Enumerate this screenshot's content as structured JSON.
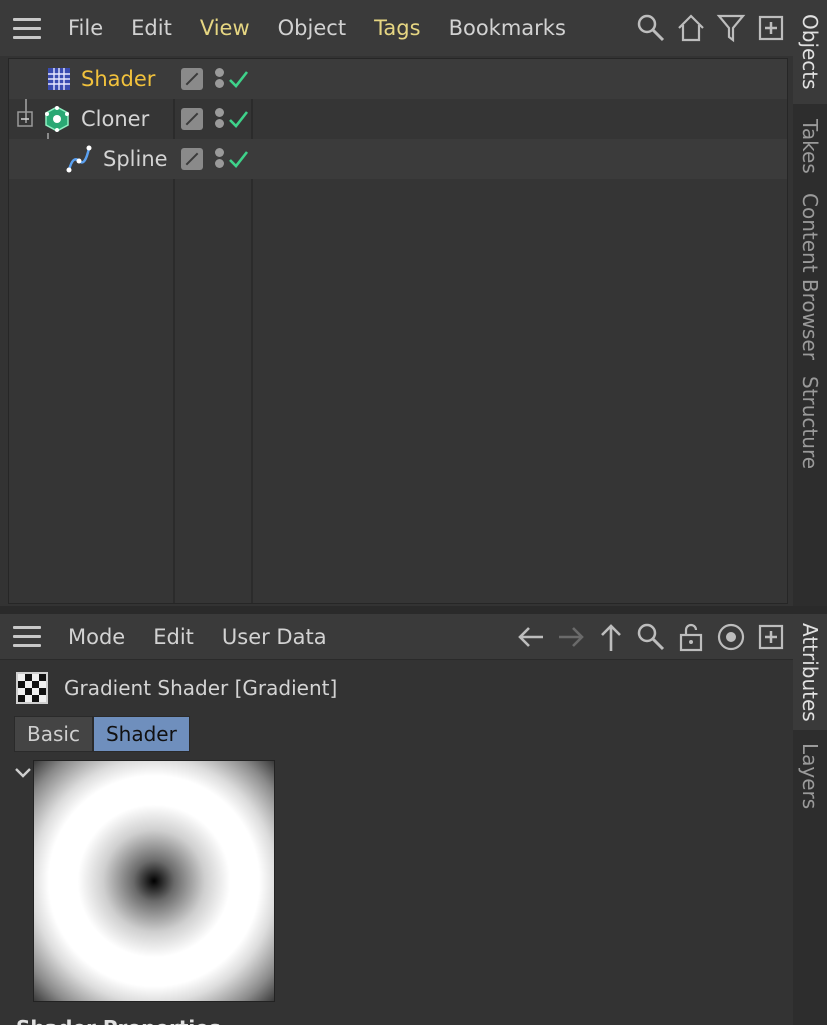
{
  "object_manager": {
    "menu": [
      "File",
      "Edit",
      "View",
      "Object",
      "Tags",
      "Bookmarks"
    ],
    "highlighted_menu": [
      "View",
      "Tags"
    ],
    "toolbar_icons": [
      "search-icon",
      "home-icon",
      "filter-icon",
      "new-window-icon"
    ],
    "objects": [
      {
        "name": "Shader",
        "icon": "shader-grid-icon",
        "selected": true
      },
      {
        "name": "Cloner",
        "icon": "cloner-icon",
        "selected": false
      },
      {
        "name": "Spline",
        "icon": "spline-icon",
        "selected": false
      }
    ]
  },
  "side_tabs_top": [
    "Objects",
    "Takes",
    "Content Browser",
    "Structure"
  ],
  "side_tabs_bottom": [
    "Attributes",
    "Layers"
  ],
  "attributes": {
    "menu": [
      "Mode",
      "Edit",
      "User Data"
    ],
    "toolbar_icons": [
      "back-arrow-icon",
      "forward-arrow-icon",
      "up-arrow-icon",
      "search-icon",
      "lock-icon",
      "target-icon",
      "new-window-icon"
    ],
    "title": "Gradient Shader [Gradient]",
    "tabs": [
      {
        "label": "Basic",
        "active": false
      },
      {
        "label": "Shader",
        "active": true
      }
    ],
    "section_heading": "Shader Properties"
  },
  "colors": {
    "selected_text": "#f2c23c",
    "menu_highlight": "#e6d682",
    "check": "#3ed28a",
    "active_tab": "#6f8fbd"
  }
}
